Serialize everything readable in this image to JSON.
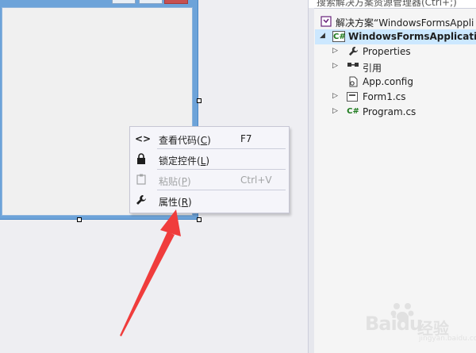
{
  "context_menu": {
    "items": [
      {
        "label": "查看代码",
        "mnemonic": "C",
        "shortcut": "F7",
        "icon": "code-icon",
        "enabled": true
      },
      {
        "label": "锁定控件",
        "mnemonic": "L",
        "shortcut": "",
        "icon": "lock-icon",
        "enabled": true
      },
      {
        "label": "粘贴",
        "mnemonic": "P",
        "shortcut": "Ctrl+V",
        "icon": "paste-icon",
        "enabled": false
      },
      {
        "label": "属性",
        "mnemonic": "R",
        "shortcut": "",
        "icon": "wrench-icon",
        "enabled": true
      }
    ]
  },
  "solution_explorer": {
    "search_placeholder": "搜索解决方案资源管理器(Ctrl+;)",
    "solution_label": "解决方案“WindowsFormsAppli",
    "project_label": "WindowsFormsApplicatio",
    "items": [
      {
        "label": "Properties",
        "icon": "wrench-icon",
        "expandable": true
      },
      {
        "label": "引用",
        "icon": "references-icon",
        "expandable": true
      },
      {
        "label": "App.config",
        "icon": "config-file-icon",
        "expandable": false
      },
      {
        "label": "Form1.cs",
        "icon": "form-icon",
        "expandable": true
      },
      {
        "label": "Program.cs",
        "icon": "csharp-file-icon",
        "expandable": true
      }
    ]
  },
  "watermark": {
    "text": "Baidu",
    "cn": "经验",
    "sub": "jingyan.baidu.com"
  },
  "colors": {
    "arrow": "#f03c3c",
    "selection": "#cce8ff",
    "menu_bg": "#f5f5fa",
    "accent_green": "#1c7a1c"
  }
}
